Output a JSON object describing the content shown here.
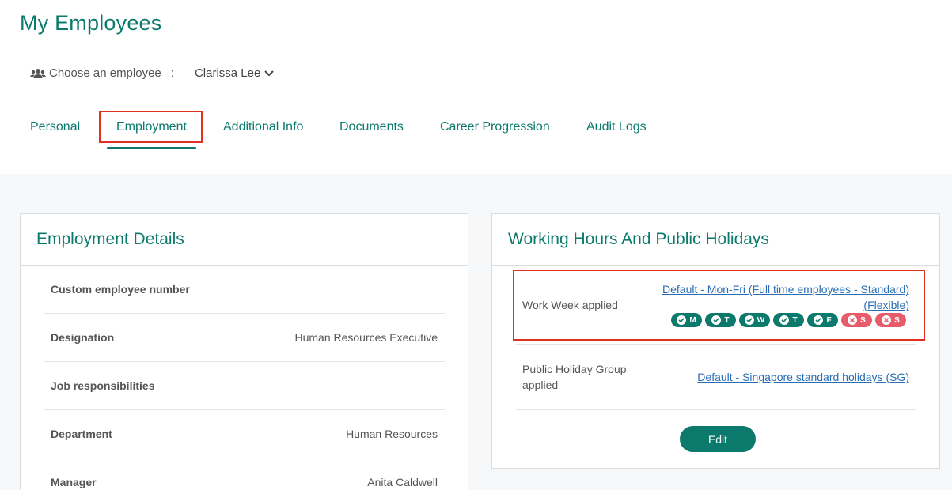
{
  "page": {
    "title": "My Employees"
  },
  "chooser": {
    "label": "Choose an employee",
    "colon": ":",
    "selected_employee": "Clarissa Lee"
  },
  "tabs": [
    {
      "label": "Personal"
    },
    {
      "label": "Employment",
      "active": true
    },
    {
      "label": "Additional Info"
    },
    {
      "label": "Documents"
    },
    {
      "label": "Career Progression"
    },
    {
      "label": "Audit Logs"
    }
  ],
  "employment_details": {
    "title": "Employment Details",
    "rows": [
      {
        "label": "Custom employee number",
        "value": ""
      },
      {
        "label": "Designation",
        "value": "Human Resources Executive"
      },
      {
        "label": "Job responsibilities",
        "value": ""
      },
      {
        "label": "Department",
        "value": "Human Resources"
      },
      {
        "label": "Manager",
        "value": "Anita Caldwell"
      }
    ]
  },
  "working_hours": {
    "title": "Working Hours And Public Holidays",
    "work_week_label": "Work Week applied",
    "work_week_link_line1": "Default - Mon-Fri (Full time employees - Standard)",
    "work_week_link_line2": "(Flexible)",
    "days": [
      {
        "letter": "M",
        "working": true
      },
      {
        "letter": "T",
        "working": true
      },
      {
        "letter": "W",
        "working": true
      },
      {
        "letter": "T",
        "working": true
      },
      {
        "letter": "F",
        "working": true
      },
      {
        "letter": "S",
        "working": false
      },
      {
        "letter": "S",
        "working": false
      }
    ],
    "holiday_label_line1": "Public Holiday Group",
    "holiday_label_line2": "applied",
    "holiday_link": "Default - Singapore standard holidays (SG)",
    "edit_label": "Edit"
  },
  "colors": {
    "accent": "#0b7a6d",
    "link": "#2a6db5",
    "off_day": "#e85c6a",
    "highlight": "#e0301e"
  }
}
